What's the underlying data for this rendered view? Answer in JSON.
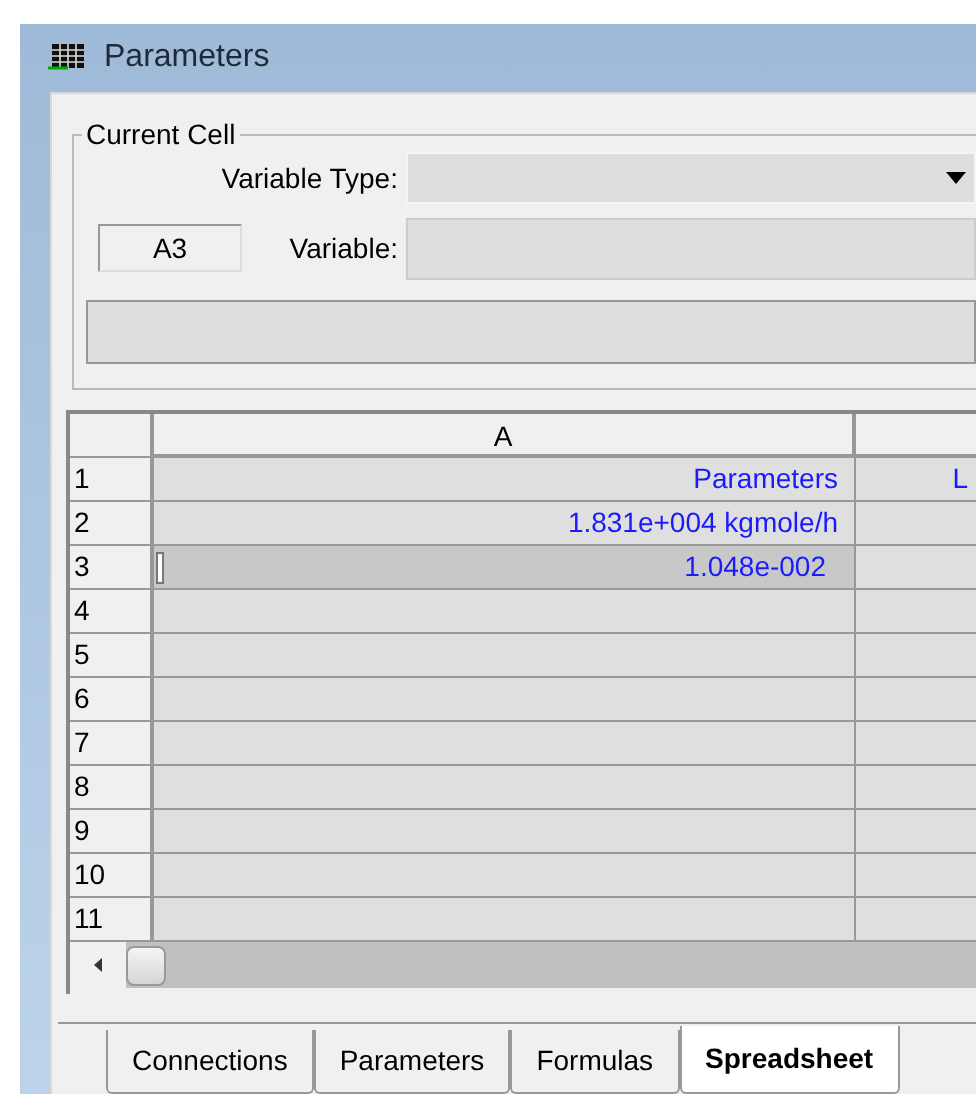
{
  "window": {
    "title": "Parameters"
  },
  "current_cell": {
    "title": "Current Cell",
    "variable_type_label": "Variable Type:",
    "cell_ref": "A3",
    "variable_label": "Variable:"
  },
  "grid": {
    "columns": [
      "A"
    ],
    "rows": [
      {
        "header": "1",
        "column_a": "Parameters",
        "column_2": "L",
        "selected": false
      },
      {
        "header": "2",
        "column_a": "1.831e+004 kgmole/h",
        "selected": false
      },
      {
        "header": "3",
        "column_a": "1.048e-002",
        "selected": true
      },
      {
        "header": "4",
        "selected": false
      },
      {
        "header": "5",
        "selected": false
      },
      {
        "header": "6",
        "selected": false
      },
      {
        "header": "7",
        "selected": false
      },
      {
        "header": "8",
        "selected": false
      },
      {
        "header": "9",
        "selected": false
      },
      {
        "header": "10",
        "selected": false
      },
      {
        "header": "11",
        "selected": false
      }
    ]
  },
  "tabs": [
    {
      "label": "Connections",
      "selected": false
    },
    {
      "label": "Parameters",
      "selected": false
    },
    {
      "label": "Formulas",
      "selected": false
    },
    {
      "label": "Spreadsheet",
      "selected": true
    }
  ]
}
